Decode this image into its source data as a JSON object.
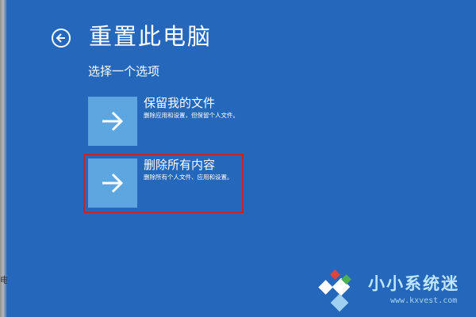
{
  "colors": {
    "background": "#2467bb",
    "tile": "#5ea6df",
    "highlight": "#c0262d",
    "watermark_text": "#bfe6ff"
  },
  "left_edge_fragments": [
    "电"
  ],
  "header": {
    "back_icon": "back-arrow-circle-icon",
    "title": "重置此电脑"
  },
  "subtitle": "选择一个选项",
  "options": [
    {
      "icon": "arrow-right-icon",
      "title": "保留我的文件",
      "description": "删除应用和设置，但保留个人文件。"
    },
    {
      "icon": "arrow-right-icon",
      "title": "删除所有内容",
      "description": "删除所有个人文件、应用和设置。"
    }
  ],
  "watermark": {
    "text": "小小系统迷",
    "url": "www.kxvest.com"
  }
}
